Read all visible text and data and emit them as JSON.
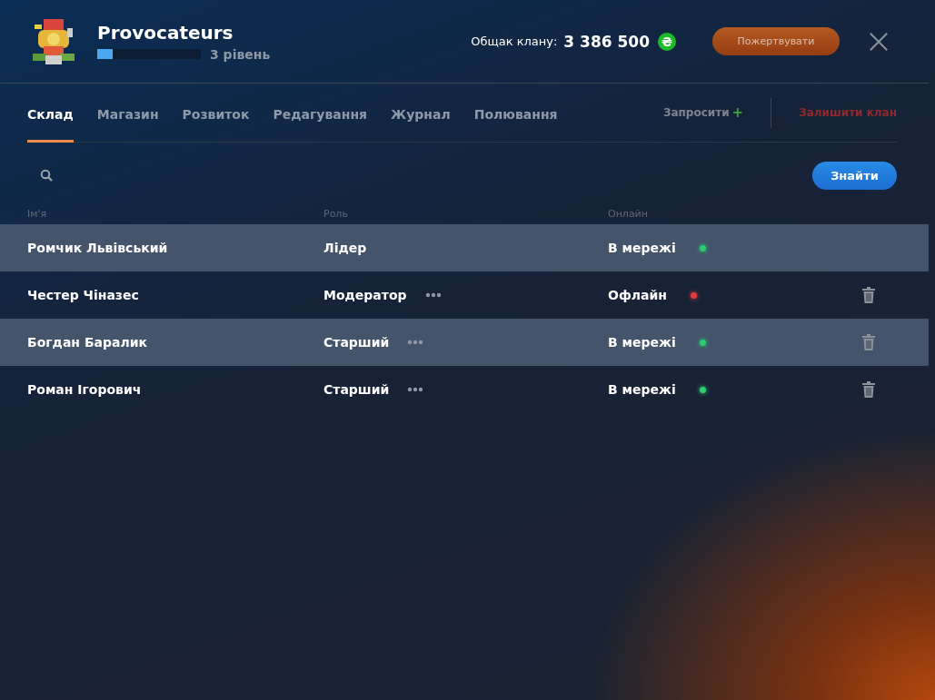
{
  "clan": {
    "name": "Provocateurs",
    "level": 0.15,
    "level_label": "3 рівень"
  },
  "treasury": {
    "label": "Общак клану:",
    "amount": "3 386 500",
    "currency_symbol": "₴"
  },
  "donate_button": "Пожертвувати",
  "tabs": [
    {
      "label": "Склад",
      "selected": true
    },
    {
      "label": "Магазин",
      "selected": false
    },
    {
      "label": "Розвиток",
      "selected": false
    },
    {
      "label": "Редагування",
      "selected": false
    },
    {
      "label": "Журнал",
      "selected": false
    },
    {
      "label": "Полювання",
      "selected": false
    }
  ],
  "invite_link": {
    "label": "Запросити",
    "icon": "+"
  },
  "leave_link": "Залишити клан",
  "search": {
    "button": "Знайти"
  },
  "table": {
    "columns": [
      "Ім'я",
      "Роль",
      "Онлайн"
    ],
    "rows": [
      {
        "name": "Ромчик Львівський",
        "role": "Лідер",
        "menu": false,
        "online": "В мережі",
        "color": "#2ecc71",
        "deletable": false
      },
      {
        "name": "Честер Чіназес",
        "role": "Модератор",
        "menu": true,
        "online": "Офлайн",
        "color": "#e0393e",
        "deletable": true
      },
      {
        "name": "Богдан Баралик",
        "role": "Старший",
        "menu": true,
        "online": "В мережі",
        "color": "#2ecc71",
        "deletable": true
      },
      {
        "name": "Роман Ігорович",
        "role": "Старший",
        "menu": true,
        "online": "В мережі",
        "color": "#2ecc71",
        "deletable": true
      }
    ]
  }
}
